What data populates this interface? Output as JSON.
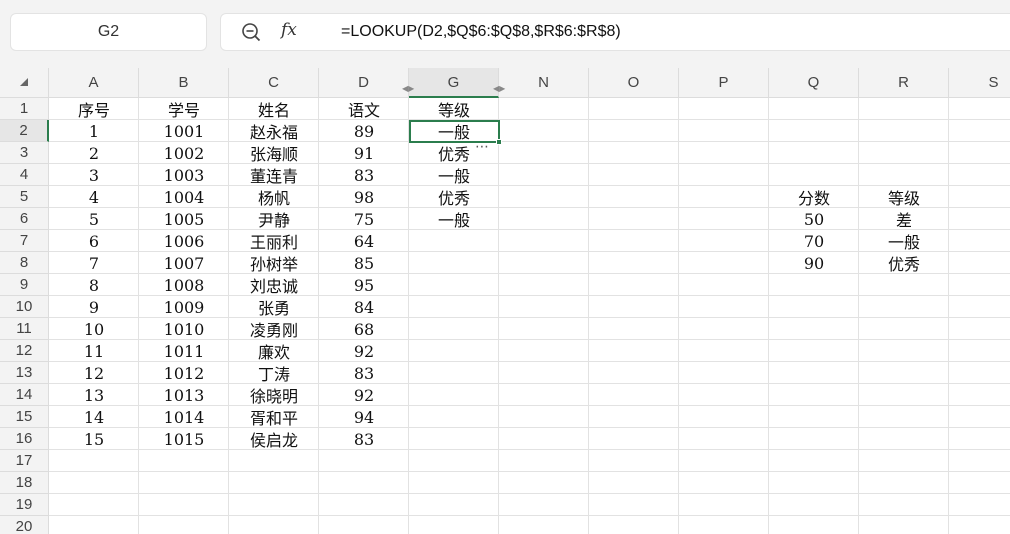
{
  "name_box": "G2",
  "formula": "=LOOKUP(D2,$Q$6:$Q$8,$R$6:$R$8)",
  "icons": {
    "zoom": "zoom-out-icon",
    "fx": "fx-icon",
    "more": "more-icon",
    "hidden_marks": "hidden-columns-arrows-icon"
  },
  "columns": [
    {
      "key": "A",
      "label": "A"
    },
    {
      "key": "B",
      "label": "B"
    },
    {
      "key": "C",
      "label": "C"
    },
    {
      "key": "D",
      "label": "D"
    },
    {
      "key": "G",
      "label": "G"
    },
    {
      "key": "N",
      "label": "N"
    },
    {
      "key": "O",
      "label": "O"
    },
    {
      "key": "P",
      "label": "P"
    },
    {
      "key": "Q",
      "label": "Q"
    },
    {
      "key": "R",
      "label": "R"
    },
    {
      "key": "S",
      "label": "S"
    }
  ],
  "selected_column": "G",
  "selected_row": 2,
  "row_numbers": [
    "1",
    "2",
    "3",
    "4",
    "5",
    "6",
    "7",
    "8",
    "9",
    "10",
    "11",
    "12",
    "13",
    "14",
    "15",
    "16",
    "17",
    "18",
    "19",
    "20"
  ],
  "rows": [
    {
      "A": "序号",
      "B": "学号",
      "C": "姓名",
      "D": "语文",
      "G": "等级"
    },
    {
      "A": "1",
      "B": "1001",
      "C": "赵永福",
      "D": "89",
      "G": "一般"
    },
    {
      "A": "2",
      "B": "1002",
      "C": "张海顺",
      "D": "91",
      "G": "优秀"
    },
    {
      "A": "3",
      "B": "1003",
      "C": "董连青",
      "D": "83",
      "G": "一般"
    },
    {
      "A": "4",
      "B": "1004",
      "C": "杨帆",
      "D": "98",
      "G": "优秀",
      "Q": "分数",
      "R": "等级"
    },
    {
      "A": "5",
      "B": "1005",
      "C": "尹静",
      "D": "75",
      "G": "一般",
      "Q": "50",
      "R": "差"
    },
    {
      "A": "6",
      "B": "1006",
      "C": "王丽利",
      "D": "64",
      "Q": "70",
      "R": "一般"
    },
    {
      "A": "7",
      "B": "1007",
      "C": "孙树举",
      "D": "85",
      "Q": "90",
      "R": "优秀"
    },
    {
      "A": "8",
      "B": "1008",
      "C": "刘忠诚",
      "D": "95"
    },
    {
      "A": "9",
      "B": "1009",
      "C": "张勇",
      "D": "84"
    },
    {
      "A": "10",
      "B": "1010",
      "C": "凌勇刚",
      "D": "68"
    },
    {
      "A": "11",
      "B": "1011",
      "C": "廉欢",
      "D": "92"
    },
    {
      "A": "12",
      "B": "1012",
      "C": "丁涛",
      "D": "83"
    },
    {
      "A": "13",
      "B": "1013",
      "C": "徐晓明",
      "D": "92"
    },
    {
      "A": "14",
      "B": "1014",
      "C": "胥和平",
      "D": "94"
    },
    {
      "A": "15",
      "B": "1015",
      "C": "侯启龙",
      "D": "83"
    },
    {},
    {},
    {},
    {}
  ],
  "colors": {
    "accent": "#2b7d4d",
    "header_bg": "#f3f3f3",
    "grid_line": "#e2e2e2"
  }
}
